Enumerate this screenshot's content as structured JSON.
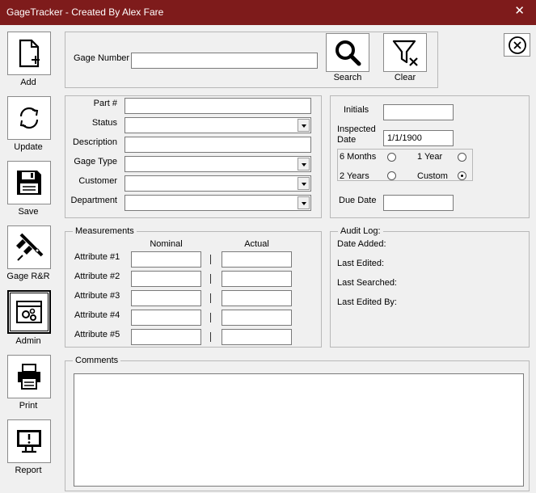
{
  "window": {
    "title": "GageTracker - Created By Alex Fare",
    "close_glyph": "✕"
  },
  "sidebar": {
    "items": [
      {
        "label": "Add",
        "icon": "add-file-icon"
      },
      {
        "label": "Update",
        "icon": "refresh-icon"
      },
      {
        "label": "Save",
        "icon": "floppy-disk-icon"
      },
      {
        "label": "Gage R&R",
        "icon": "caliper-icon"
      },
      {
        "label": "Admin",
        "icon": "admin-settings-icon"
      },
      {
        "label": "Print",
        "icon": "printer-icon"
      },
      {
        "label": "Report",
        "icon": "monitor-alert-icon"
      }
    ],
    "selected": "Admin"
  },
  "search": {
    "gage_number_label": "Gage Number",
    "gage_number_value": "",
    "search_label": "Search",
    "clear_label": "Clear"
  },
  "details": {
    "part_label": "Part #",
    "part_value": "",
    "status_label": "Status",
    "status_value": "",
    "description_label": "Description",
    "description_value": "",
    "gage_type_label": "Gage Type",
    "gage_type_value": "",
    "customer_label": "Customer",
    "customer_value": "",
    "department_label": "Department",
    "department_value": ""
  },
  "inspection": {
    "initials_label": "Initials",
    "initials_value": "",
    "inspected_date_label_1": "Inspected",
    "inspected_date_label_2": "Date",
    "inspected_date_value": "1/1/1900",
    "frequency_options": [
      "6 Months",
      "1 Year",
      "2 Years",
      "Custom"
    ],
    "frequency_selected": "Custom",
    "due_date_label": "Due Date",
    "due_date_value": ""
  },
  "measurements": {
    "legend": "Measurements",
    "nominal_header": "Nominal",
    "actual_header": "Actual",
    "rows": [
      {
        "label": "Attribute #1",
        "nominal": "",
        "actual": ""
      },
      {
        "label": "Attribute #2",
        "nominal": "",
        "actual": ""
      },
      {
        "label": "Attribute #3",
        "nominal": "",
        "actual": ""
      },
      {
        "label": "Attribute #4",
        "nominal": "",
        "actual": ""
      },
      {
        "label": "Attribute #5",
        "nominal": "",
        "actual": ""
      }
    ],
    "separator": "|"
  },
  "audit": {
    "legend": "Audit Log:",
    "date_added_label": "Date Added:",
    "last_edited_label": "Last Edited:",
    "last_searched_label": "Last Searched:",
    "last_edited_by_label": "Last Edited By:"
  },
  "comments": {
    "legend": "Comments",
    "value": ""
  }
}
